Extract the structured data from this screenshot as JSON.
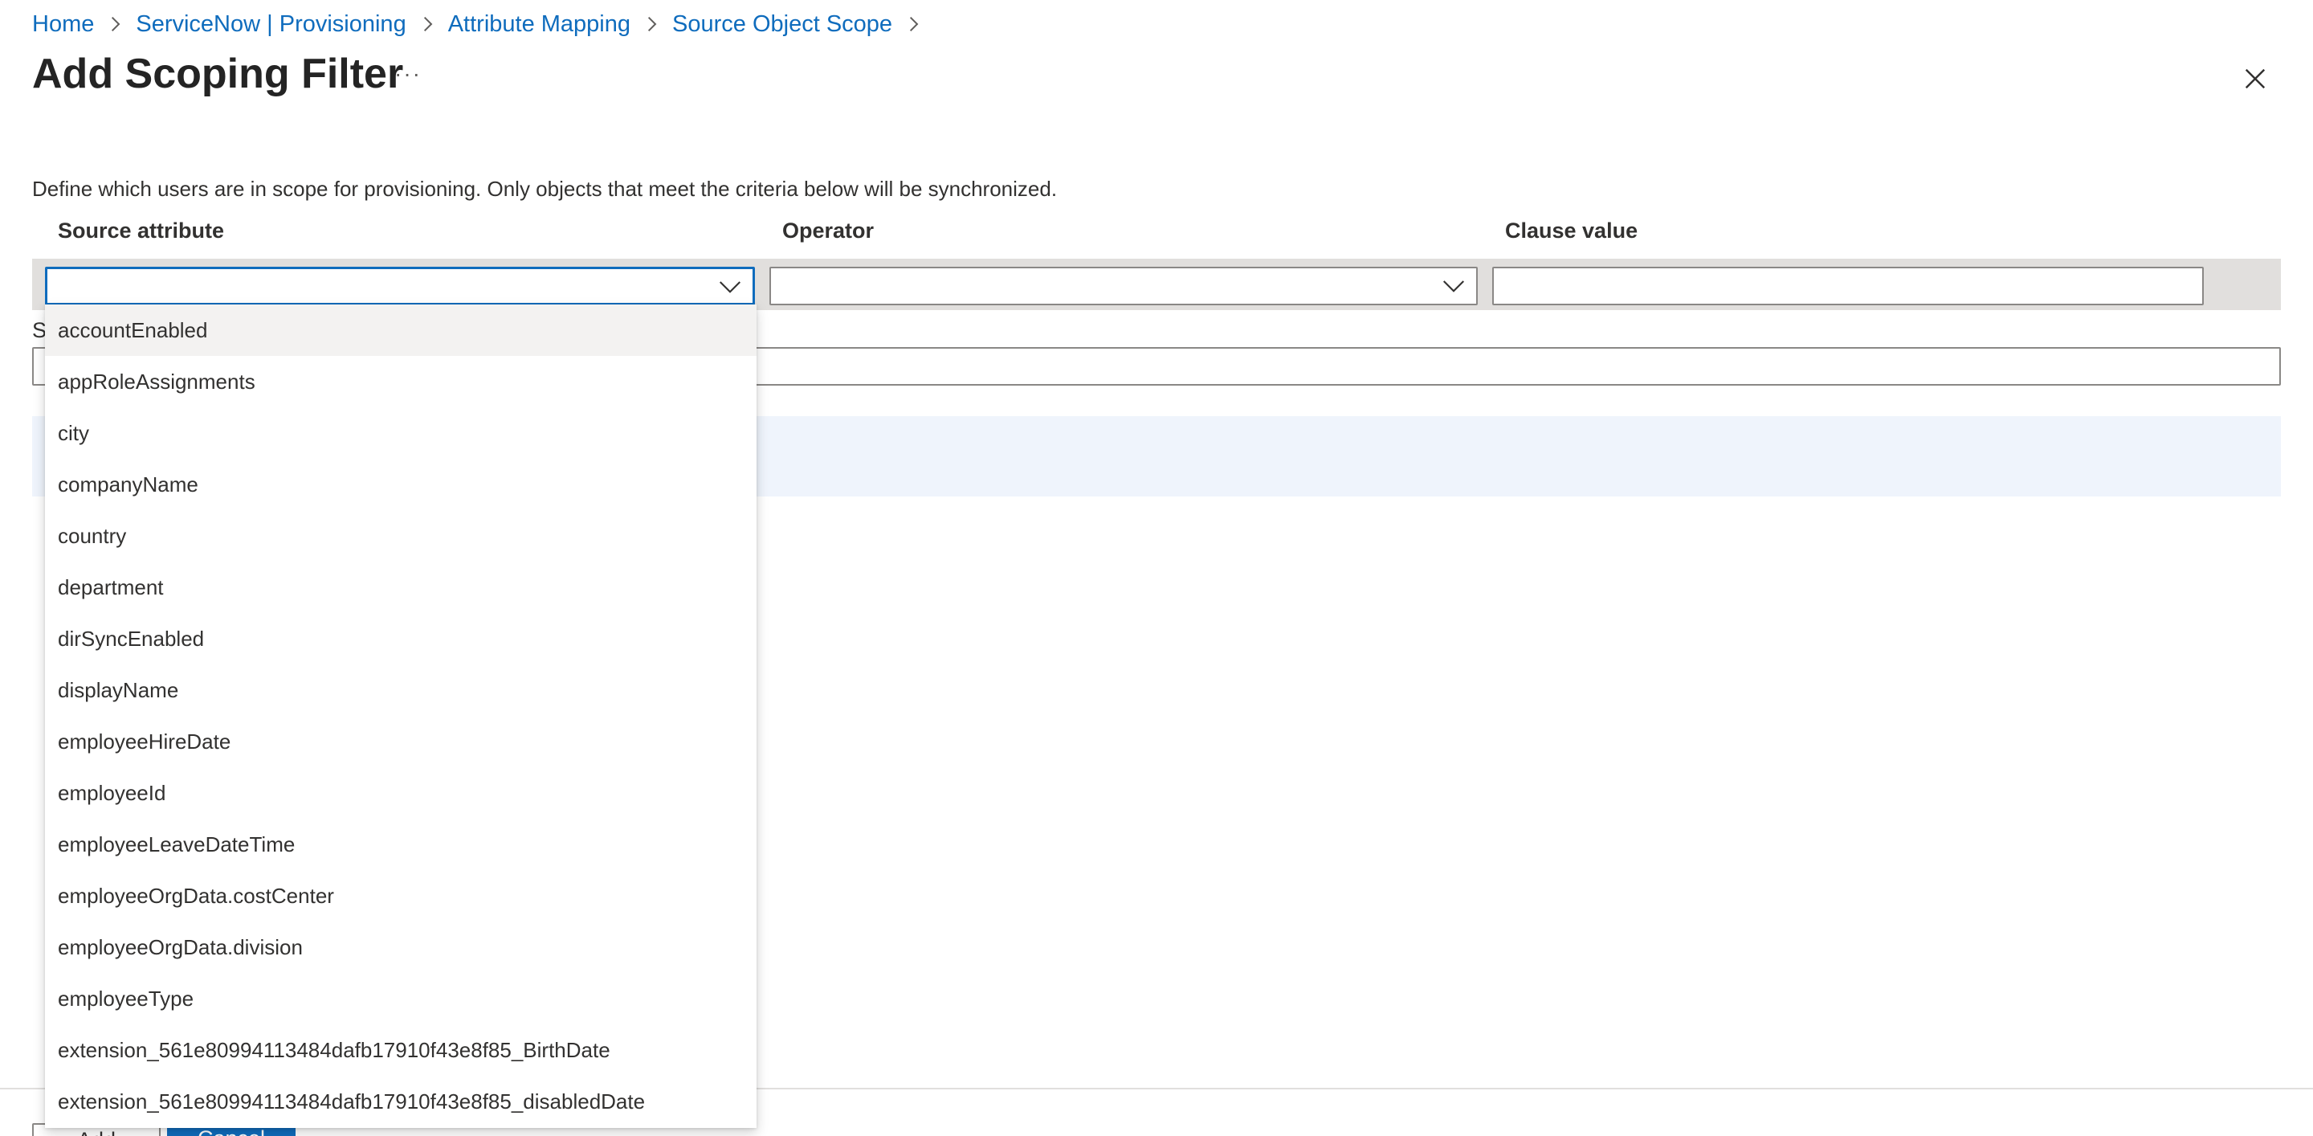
{
  "breadcrumb": [
    {
      "label": "Home"
    },
    {
      "label": "ServiceNow | Provisioning"
    },
    {
      "label": "Attribute Mapping"
    },
    {
      "label": "Source Object Scope"
    }
  ],
  "page": {
    "title": "Add Scoping Filter",
    "more_label": "···",
    "description": "Define which users are in scope for provisioning. Only objects that meet the criteria below will be synchronized."
  },
  "columns": {
    "source_attribute": "Source attribute",
    "operator": "Operator",
    "clause_value": "Clause value"
  },
  "clause": {
    "source_attribute_value": "",
    "operator_value": "",
    "clause_value": ""
  },
  "hidden_label_fragment": "S",
  "dropdown": {
    "hovered_index": 0,
    "options": [
      "accountEnabled",
      "appRoleAssignments",
      "city",
      "companyName",
      "country",
      "department",
      "dirSyncEnabled",
      "displayName",
      "employeeHireDate",
      "employeeId",
      "employeeLeaveDateTime",
      "employeeOrgData.costCenter",
      "employeeOrgData.division",
      "employeeType",
      "extension_561e80994113484dafb17910f43e8f85_BirthDate",
      "extension_561e80994113484dafb17910f43e8f85_disabledDate"
    ]
  },
  "footer": {
    "add_label": "Add",
    "cancel_label": "Cancel"
  },
  "colors": {
    "link": "#0f6cbd",
    "primary": "#0f6cbd",
    "row_bg": "#e1dfdd",
    "info_bg": "#eff4fc"
  }
}
